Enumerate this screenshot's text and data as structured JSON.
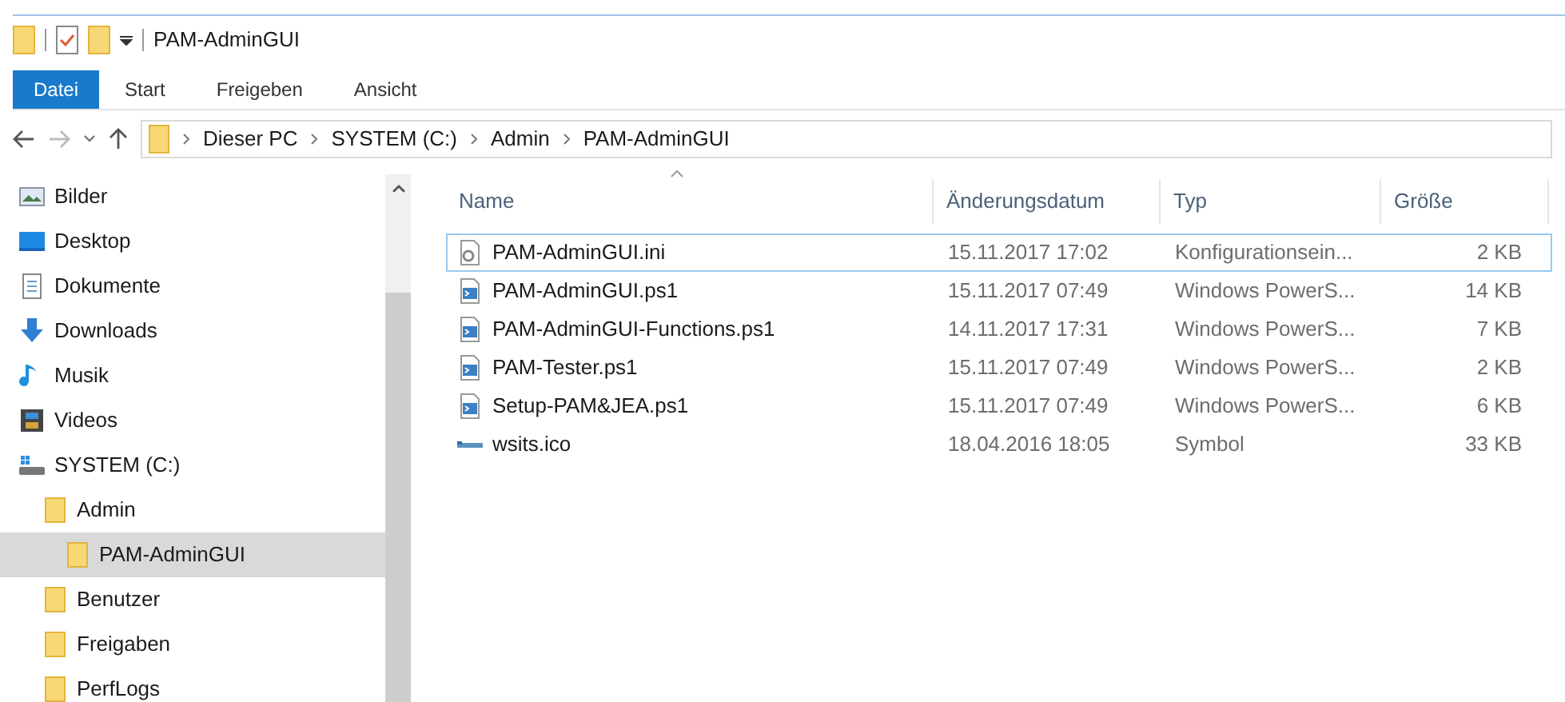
{
  "window": {
    "title": "PAM-AdminGUI"
  },
  "ribbon_tabs": [
    {
      "label": "Datei",
      "selected": true
    },
    {
      "label": "Start",
      "selected": false
    },
    {
      "label": "Freigeben",
      "selected": false
    },
    {
      "label": "Ansicht",
      "selected": false
    }
  ],
  "address_bar": {
    "path": [
      "Dieser PC",
      "SYSTEM (C:)",
      "Admin",
      "PAM-AdminGUI"
    ]
  },
  "navigation": [
    {
      "label": "Bilder",
      "kind": "pictures",
      "selected": false
    },
    {
      "label": "Desktop",
      "kind": "desktop",
      "selected": false
    },
    {
      "label": "Dokumente",
      "kind": "documents",
      "selected": false
    },
    {
      "label": "Downloads",
      "kind": "downloads",
      "selected": false
    },
    {
      "label": "Musik",
      "kind": "music",
      "selected": false
    },
    {
      "label": "Videos",
      "kind": "videos",
      "selected": false
    },
    {
      "label": "SYSTEM (C:)",
      "kind": "drive",
      "selected": false,
      "children": [
        {
          "label": "Admin",
          "kind": "folder",
          "selected": false,
          "children": [
            {
              "label": "PAM-AdminGUI",
              "kind": "folder",
              "selected": true
            }
          ]
        },
        {
          "label": "Benutzer",
          "kind": "folder",
          "selected": false
        },
        {
          "label": "Freigaben",
          "kind": "folder",
          "selected": false
        },
        {
          "label": "PerfLogs",
          "kind": "folder",
          "selected": false
        }
      ]
    }
  ],
  "file_list": {
    "columns": [
      "Name",
      "Änderungsdatum",
      "Typ",
      "Größe"
    ],
    "rows": [
      {
        "kind": "config",
        "name": "PAM-AdminGUI.ini",
        "modified": "15.11.2017 17:02",
        "type": "Konfigurationsein...",
        "size": "2 KB",
        "focused": true
      },
      {
        "kind": "script",
        "name": "PAM-AdminGUI.ps1",
        "modified": "15.11.2017 07:49",
        "type": "Windows PowerS...",
        "size": "14 KB",
        "focused": false
      },
      {
        "kind": "script",
        "name": "PAM-AdminGUI-Functions.ps1",
        "modified": "14.11.2017 17:31",
        "type": "Windows PowerS...",
        "size": "7 KB",
        "focused": false
      },
      {
        "kind": "script",
        "name": "PAM-Tester.ps1",
        "modified": "15.11.2017 07:49",
        "type": "Windows PowerS...",
        "size": "2 KB",
        "focused": false
      },
      {
        "kind": "script",
        "name": "Setup-PAM&JEA.ps1",
        "modified": "15.11.2017 07:49",
        "type": "Windows PowerS...",
        "size": "6 KB",
        "focused": false
      },
      {
        "kind": "icon",
        "name": "wsits.ico",
        "modified": "18.04.2016 18:05",
        "type": "Symbol",
        "size": "33 KB",
        "focused": false
      }
    ]
  }
}
